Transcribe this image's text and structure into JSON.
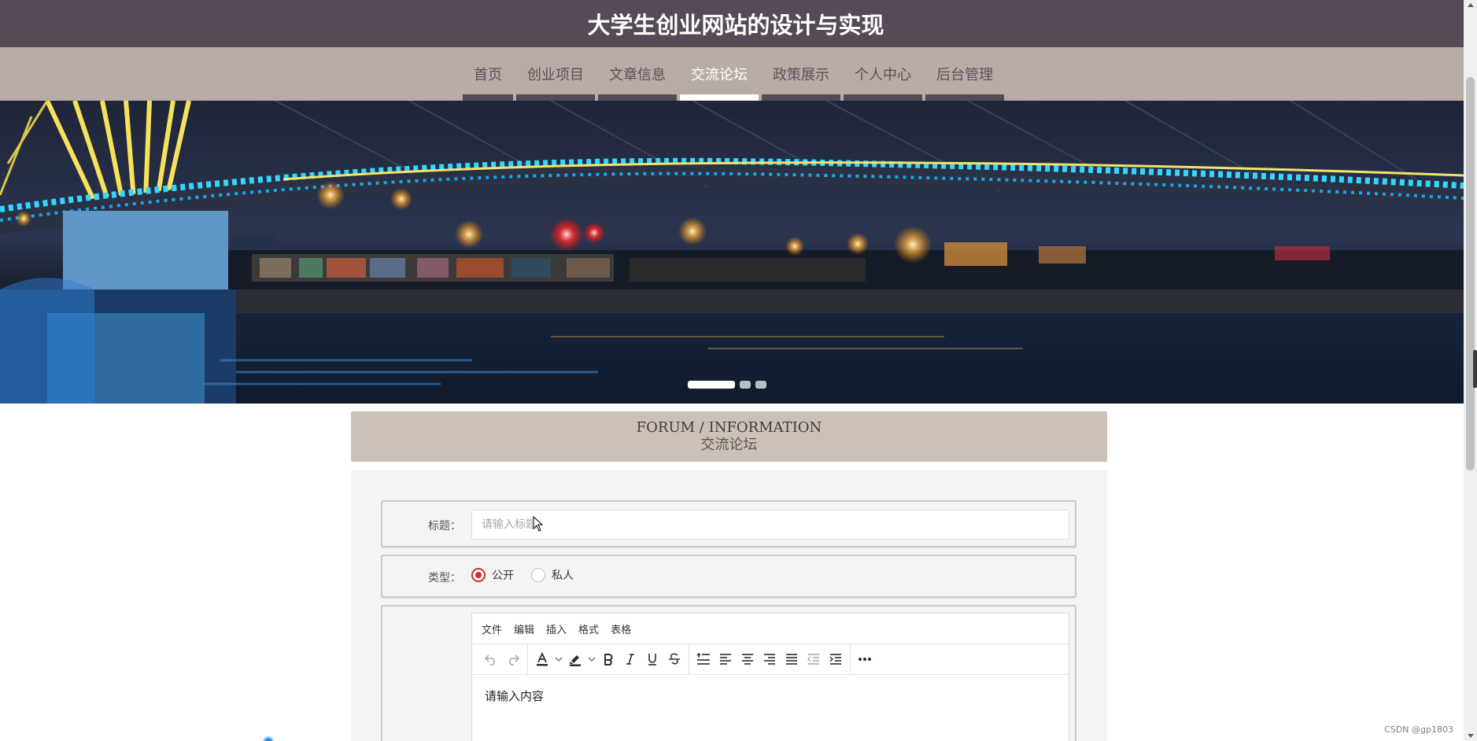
{
  "site": {
    "title": "大学生创业网站的设计与实现",
    "header_color": "#554a55",
    "nav_color": "#b8ada6"
  },
  "nav": {
    "items": [
      {
        "label": "首页",
        "active": false
      },
      {
        "label": "创业项目",
        "active": false
      },
      {
        "label": "文章信息",
        "active": false
      },
      {
        "label": "交流论坛",
        "active": true
      },
      {
        "label": "政策展示",
        "active": false
      },
      {
        "label": "个人中心",
        "active": false
      },
      {
        "label": "后台管理",
        "active": false
      }
    ]
  },
  "carousel": {
    "slide_count": 3,
    "active_index": 0
  },
  "section": {
    "title_en": "FORUM / INFORMATION",
    "title_cn": "交流论坛"
  },
  "form": {
    "title_label": "标题：",
    "title_value": "",
    "title_placeholder": "请输入标题",
    "type_label": "类型：",
    "type_options": [
      {
        "label": "公开",
        "checked": true
      },
      {
        "label": "私人",
        "checked": false
      }
    ],
    "accent_color": "#d12b2b"
  },
  "editor": {
    "menu": [
      "文件",
      "编辑",
      "插入",
      "格式",
      "表格"
    ],
    "content": "请输入内容",
    "toolbar_icons": [
      "undo-icon",
      "redo-icon",
      "text-color-icon",
      "highlight-icon",
      "bold-icon",
      "italic-icon",
      "underline-icon",
      "strikethrough-icon",
      "line-height-icon",
      "align-left-icon",
      "align-center-icon",
      "align-right-icon",
      "align-justify-icon",
      "outdent-icon",
      "indent-icon",
      "more-icon"
    ]
  },
  "watermark": "CSDN @gp1803"
}
